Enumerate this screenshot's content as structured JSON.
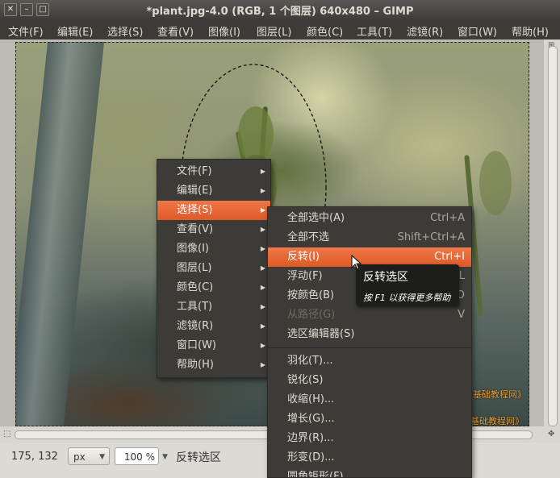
{
  "window": {
    "title": "*plant.jpg-4.0 (RGB, 1 个图层) 640x480 – GIMP",
    "close_glyph": "✕",
    "minimize_glyph": "–",
    "maximize_glyph": "□"
  },
  "menubar": [
    "文件(F)",
    "编辑(E)",
    "选择(S)",
    "查看(V)",
    "图像(I)",
    "图层(L)",
    "颜色(C)",
    "工具(T)",
    "滤镜(R)",
    "窗口(W)",
    "帮助(H)"
  ],
  "context_menu": {
    "items": [
      {
        "label": "文件(F)"
      },
      {
        "label": "编辑(E)"
      },
      {
        "label": "选择(S)",
        "active": true
      },
      {
        "label": "查看(V)"
      },
      {
        "label": "图像(I)"
      },
      {
        "label": "图层(L)"
      },
      {
        "label": "颜色(C)"
      },
      {
        "label": "工具(T)"
      },
      {
        "label": "滤镜(R)"
      },
      {
        "label": "窗口(W)"
      },
      {
        "label": "帮助(H)"
      }
    ]
  },
  "select_submenu": {
    "items": [
      {
        "label": "全部选中(A)",
        "accel": "Ctrl+A"
      },
      {
        "label": "全部不选",
        "accel": "Shift+Ctrl+A"
      },
      {
        "label": "反转(I)",
        "accel": "Ctrl+I",
        "active": true
      },
      {
        "label": "浮动(F)",
        "accel": "L"
      },
      {
        "label": "按颜色(B)",
        "accel": "O"
      },
      {
        "label": "从路径(G)",
        "accel": "V",
        "disabled": true
      },
      {
        "label": "选区编辑器(S)",
        "accel": ""
      },
      {
        "label": "羽化(T)...",
        "accel": ""
      },
      {
        "label": "锐化(S)",
        "accel": ""
      },
      {
        "label": "收缩(H)...",
        "accel": ""
      },
      {
        "label": "增长(G)...",
        "accel": ""
      },
      {
        "label": "边界(R)...",
        "accel": ""
      },
      {
        "label": "形变(D)...",
        "accel": ""
      },
      {
        "label": "圆角矩形(F)...",
        "accel": ""
      }
    ]
  },
  "tooltip": {
    "title": "反转选区",
    "hint": "按 F1 以获得更多帮助"
  },
  "watermark": {
    "line1": "《基础教程网》",
    "line2": "基础教程网》"
  },
  "statusbar": {
    "coords": "175, 132",
    "unit": "px",
    "zoom": "100 %",
    "message": "反转选区"
  },
  "colors": {
    "accent": "#e86b35",
    "menu_bg": "#3c3b37"
  }
}
